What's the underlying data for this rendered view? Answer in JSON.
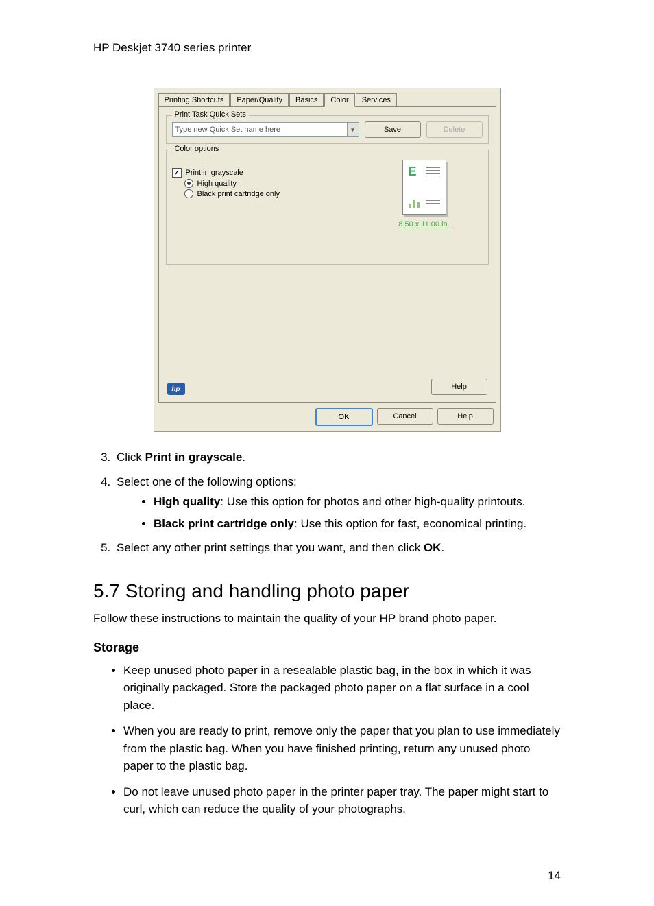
{
  "header": "HP Deskjet 3740 series printer",
  "dialog": {
    "tabs": [
      "Printing Shortcuts",
      "Paper/Quality",
      "Basics",
      "Color",
      "Services"
    ],
    "active_tab": 3,
    "quickset": {
      "legend": "Print Task Quick Sets",
      "placeholder": "Type new Quick Set name here",
      "save": "Save",
      "delete": "Delete"
    },
    "color_options": {
      "legend": "Color options",
      "grayscale": "Print in grayscale",
      "high_quality": "High quality",
      "black_only": "Black print cartridge only"
    },
    "preview_size": "8.50 x 11.00 in.",
    "help": "Help",
    "buttons": {
      "ok": "OK",
      "cancel": "Cancel",
      "help": "Help"
    },
    "hp_text": "hp"
  },
  "step3_pre": "Click ",
  "step3_bold": "Print in grayscale",
  "step3_post": ".",
  "step4": "Select one of the following options:",
  "step4_hq_bold": "High quality",
  "step4_hq_text": ": Use this option for photos and other high-quality printouts.",
  "step4_bk_bold": "Black print cartridge only",
  "step4_bk_text": ": Use this option for fast, economical printing.",
  "step5_pre": "Select any other print settings that you want, and then click ",
  "step5_bold": "OK",
  "step5_post": ".",
  "section_title": "5.7  Storing and handling photo paper",
  "intro": "Follow these instructions to maintain the quality of your HP brand photo paper.",
  "storage_heading": "Storage",
  "storage_b1": "Keep unused photo paper in a resealable plastic bag, in the box in which it was originally packaged. Store the packaged photo paper on a flat surface in a cool place.",
  "storage_b2": "When you are ready to print, remove only the paper that you plan to use immediately from the plastic bag. When you have finished printing, return any unused photo paper to the plastic bag.",
  "storage_b3": "Do not leave unused photo paper in the printer paper tray. The paper might start to curl, which can reduce the quality of your photographs.",
  "page_number": "14"
}
